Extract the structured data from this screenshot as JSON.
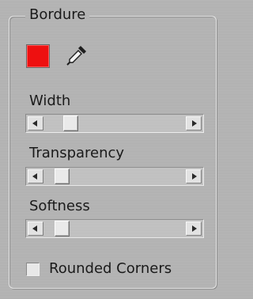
{
  "panel": {
    "title": "Bordure"
  },
  "color": {
    "swatch_color": "#ee1010",
    "picker_icon": "eyedropper-icon"
  },
  "sliders": [
    {
      "label": "Width",
      "value": 0.15
    },
    {
      "label": "Transparency",
      "value": 0.08
    },
    {
      "label": "Softness",
      "value": 0.08
    }
  ],
  "options": {
    "rounded_corners_label": "Rounded Corners",
    "rounded_corners_checked": false
  },
  "icons": {
    "scroll_left": "arrow-left-icon",
    "scroll_right": "arrow-right-icon"
  }
}
